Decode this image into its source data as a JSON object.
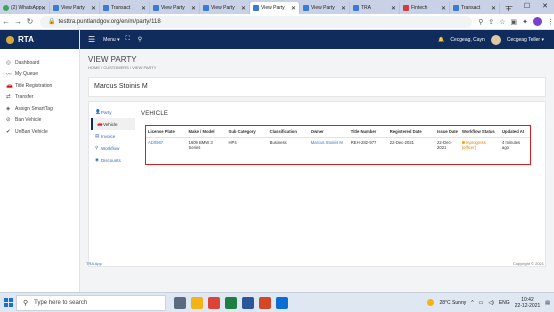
{
  "browser": {
    "tabs": [
      {
        "label": "(2) WhatsApp",
        "icon": "whatsapp-icon",
        "color": "#3ba55d",
        "active": false
      },
      {
        "label": "View Party",
        "icon": "page-icon",
        "color": "#3a7bd5",
        "active": false
      },
      {
        "label": "Transact",
        "icon": "page-icon",
        "color": "#3a7bd5",
        "active": false
      },
      {
        "label": "View Party",
        "icon": "page-icon",
        "color": "#3a7bd5",
        "active": false
      },
      {
        "label": "View Party",
        "icon": "page-icon",
        "color": "#3a7bd5",
        "active": false
      },
      {
        "label": "View Party",
        "icon": "page-icon",
        "color": "#3a7bd5",
        "active": true
      },
      {
        "label": "View Party",
        "icon": "page-icon",
        "color": "#3a7bd5",
        "active": false
      },
      {
        "label": "TRA",
        "icon": "page-icon",
        "color": "#3a7bd5",
        "active": false
      },
      {
        "label": "Fintech",
        "icon": "page-icon",
        "color": "#d43b3b",
        "active": false
      },
      {
        "label": "Transact",
        "icon": "page-icon",
        "color": "#3a7bd5",
        "active": false
      }
    ],
    "new_tab": "+",
    "url": "testtra.puntlandgov.org/en/m/party/118"
  },
  "app": {
    "brand": "RTA",
    "topbar": {
      "menu_label": "Menu ▾",
      "user_name": "Cecgeag, Cayn",
      "role_label": "Cecgeag Teller ▾"
    },
    "sidebar": [
      {
        "label": "Dashboard",
        "icon": "dashboard-icon",
        "glyph": "◎"
      },
      {
        "label": "My Queue",
        "icon": "chart-icon",
        "glyph": "〰"
      },
      {
        "label": "Title Registration",
        "icon": "car-icon",
        "glyph": "🚗"
      },
      {
        "label": "Transfer",
        "icon": "transfer-icon",
        "glyph": "⇄"
      },
      {
        "label": "Assign SmartTag",
        "icon": "tag-icon",
        "glyph": "◈"
      },
      {
        "label": "Ban Vehicle",
        "icon": "ban-icon",
        "glyph": "⊘"
      },
      {
        "label": "UnBan Vehicle",
        "icon": "check-icon",
        "glyph": "✔"
      }
    ]
  },
  "page": {
    "title": "VIEW PARTY",
    "breadcrumb": "HOME  /  CUSTOMERS  /  VIEW PARTY",
    "party_name": "Marcus Stoinis M",
    "subnav": [
      {
        "label": "Party",
        "icon": "person-icon",
        "glyph": "👤",
        "active": false
      },
      {
        "label": "Vehicle",
        "icon": "car-icon",
        "glyph": "🚗",
        "active": true
      },
      {
        "label": "Invoice",
        "icon": "invoice-icon",
        "glyph": "▤",
        "active": false
      },
      {
        "label": "Workflow",
        "icon": "workflow-icon",
        "glyph": "⚲",
        "active": false
      },
      {
        "label": "Discounts",
        "icon": "discount-icon",
        "glyph": "◉",
        "active": false
      }
    ],
    "section_title": "VEHICLE",
    "table": {
      "headers": [
        "License Plate",
        "Make / Model",
        "Sub Category",
        "Classification",
        "Owner",
        "Title Number",
        "Registered Date",
        "Issue Date",
        "Workflow Status",
        "Updated At"
      ],
      "rows": [
        [
          "AD0987",
          "1609 BMW 3 Series",
          "HP4",
          "Business",
          "Marcus Stoinis M",
          "REH-282-977",
          "22-Dec-2021",
          "22-Dec-2021",
          "Inprogress [officer]",
          "4 minutes ago"
        ]
      ]
    },
    "footer_left": "TRA App",
    "footer_right": "Copyright © 2021"
  },
  "taskbar": {
    "search_placeholder": "Type here to search",
    "apps": [
      {
        "name": "task-view-icon",
        "color": "#5a6b80"
      },
      {
        "name": "file-explorer-icon",
        "color": "#f2b318"
      },
      {
        "name": "chrome-icon",
        "color": "#db4437"
      },
      {
        "name": "excel-icon",
        "color": "#1e7e44"
      },
      {
        "name": "word-icon",
        "color": "#2b579a"
      },
      {
        "name": "powerpoint-icon",
        "color": "#d24726"
      },
      {
        "name": "photos-icon",
        "color": "#0a6dd6"
      }
    ],
    "weather": "28°C  Sunny",
    "lang": "ENG",
    "time": "10:42",
    "date": "22-12-2021"
  }
}
